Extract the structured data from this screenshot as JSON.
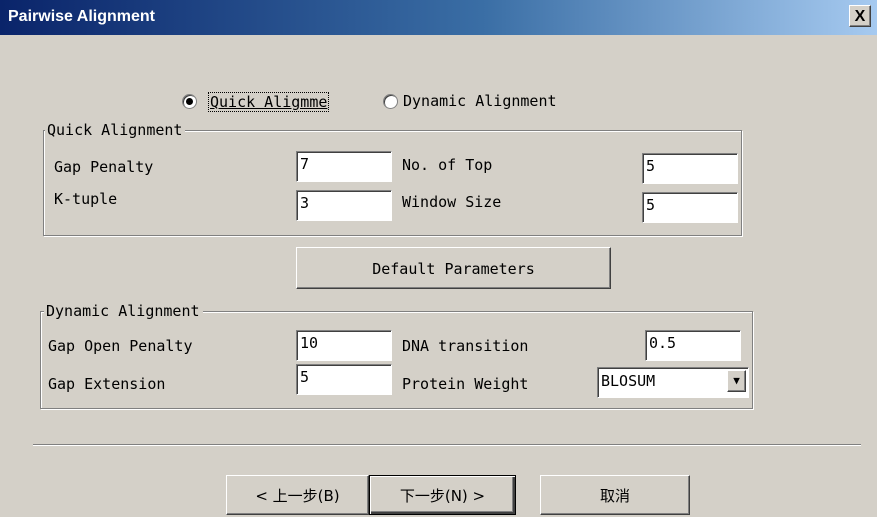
{
  "window": {
    "title": "Pairwise Alignment",
    "close_glyph": "X"
  },
  "mode": {
    "selected": "Quick Alignment",
    "quick_label": "Quick Aligmme",
    "dynamic_label": "Dynamic Alignment"
  },
  "quick_group": {
    "legend": "Quick Alignment",
    "gap_penalty_label": "Gap Penalty",
    "gap_penalty_value": "7",
    "ktuple_label": "K-tuple",
    "ktuple_value": "3",
    "no_of_top_label": "No. of Top",
    "no_of_top_value": "5",
    "window_size_label": "Window Size",
    "window_size_value": "5"
  },
  "default_parameters_label": "Default Parameters",
  "dynamic_group": {
    "legend": "Dynamic Alignment",
    "gap_open_label": "Gap Open Penalty",
    "gap_open_value": "10",
    "gap_ext_label": "Gap Extension",
    "gap_ext_value": "5",
    "dna_transition_label": "DNA transition",
    "dna_transition_value": "0.5",
    "protein_weight_label": "Protein Weight",
    "protein_weight_value": "BLOSUM"
  },
  "footer": {
    "back_label": "< 上一步(B)",
    "next_label": "下一步(N) >",
    "cancel_label": "取消"
  },
  "icons": {
    "select_arrow": "triangle-down",
    "radio_selected": "radio-dot"
  }
}
